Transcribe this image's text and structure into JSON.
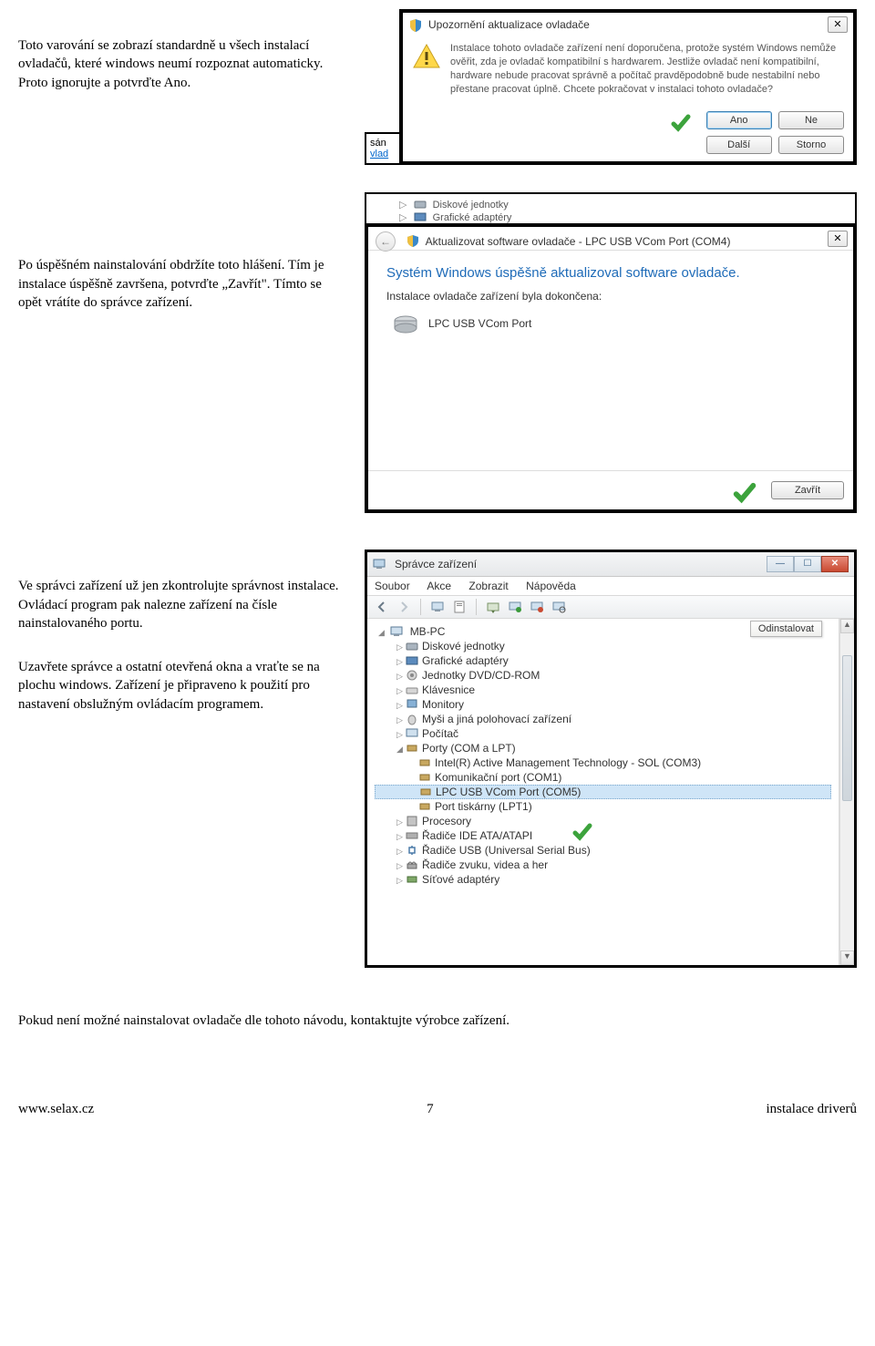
{
  "section1": {
    "para": "Toto varování se zobrazí standardně u všech instalací ovladačů, které windows neumí rozpoznat automaticky. Proto ignorujte a potvrďte Ano."
  },
  "dialog1": {
    "title": "Upozornění aktualizace ovladače",
    "body": "Instalace tohoto ovladače zařízení není doporučena, protože systém Windows nemůže ověřit, zda je ovladač kompatibilní s hardwarem. Jestliže ovladač není kompatibilní, hardware nebude pracovat správně a počítač pravděpodobně bude nestabilní nebo přestane pracovat úplně. Chcete pokračovat v instalaci tohoto ovladače?",
    "btn_yes": "Ano",
    "btn_no": "Ne",
    "btn_next": "Další",
    "btn_cancel": "Storno",
    "close_x": "✕",
    "frag_link": "vlad",
    "frag_text": "sán"
  },
  "frag_above": {
    "item1": "Diskové jednotky",
    "item2": "Grafické adaptéry"
  },
  "section2": {
    "para": "Po úspěšném nainstalování obdržíte toto hlášení. Tím je instalace úspěšně završena, potvrďte „Zavřít\". Tímto se opět vrátíte do správce zařízení."
  },
  "dialog2": {
    "header": "Aktualizovat software ovladače - LPC USB VCom Port (COM4)",
    "big": "Systém Windows úspěšně aktualizoval software ovladače.",
    "sub": "Instalace ovladače zařízení byla dokončena:",
    "device": "LPC USB VCom Port",
    "btn_close": "Zavřít",
    "close_x": "✕"
  },
  "section3": {
    "para1": "Ve správci zařízení už jen zkontrolujte správnost instalace. Ovládací program pak nalezne zařízení na čísle nainstalovaného portu.",
    "para2": "Uzavřete správce a ostatní otevřená okna a vraťte se na plochu windows. Zařízení je připraveno k použití pro nastavení obslužným ovládacím programem."
  },
  "devmgr": {
    "title": "Správce zařízení",
    "menu": {
      "file": "Soubor",
      "action": "Akce",
      "view": "Zobrazit",
      "help": "Nápověda"
    },
    "tooltip": "Odinstalovat",
    "tree": {
      "root": "MB-PC",
      "items": [
        "Diskové jednotky",
        "Grafické adaptéry",
        "Jednotky DVD/CD-ROM",
        "Klávesnice",
        "Monitory",
        "Myši a jiná polohovací zařízení",
        "Počítač",
        "Porty (COM a LPT)"
      ],
      "ports": [
        "Intel(R) Active Management Technology - SOL (COM3)",
        "Komunikační port (COM1)",
        "LPC USB VCom Port (COM5)",
        "Port tiskárny (LPT1)"
      ],
      "items2": [
        "Procesory",
        "Řadiče IDE ATA/ATAPI",
        "Řadiče USB (Universal Serial Bus)",
        "Řadiče zvuku, videa a her",
        "Síťové adaptéry"
      ]
    }
  },
  "final": "Pokud není možné nainstalovat ovladače dle tohoto návodu, kontaktujte výrobce zařízení.",
  "footer": {
    "left": "www.selax.cz",
    "center": "7",
    "right": "instalace driverů"
  },
  "icons": {
    "shield": "🛡",
    "drive": "💾",
    "computer": "💻"
  }
}
